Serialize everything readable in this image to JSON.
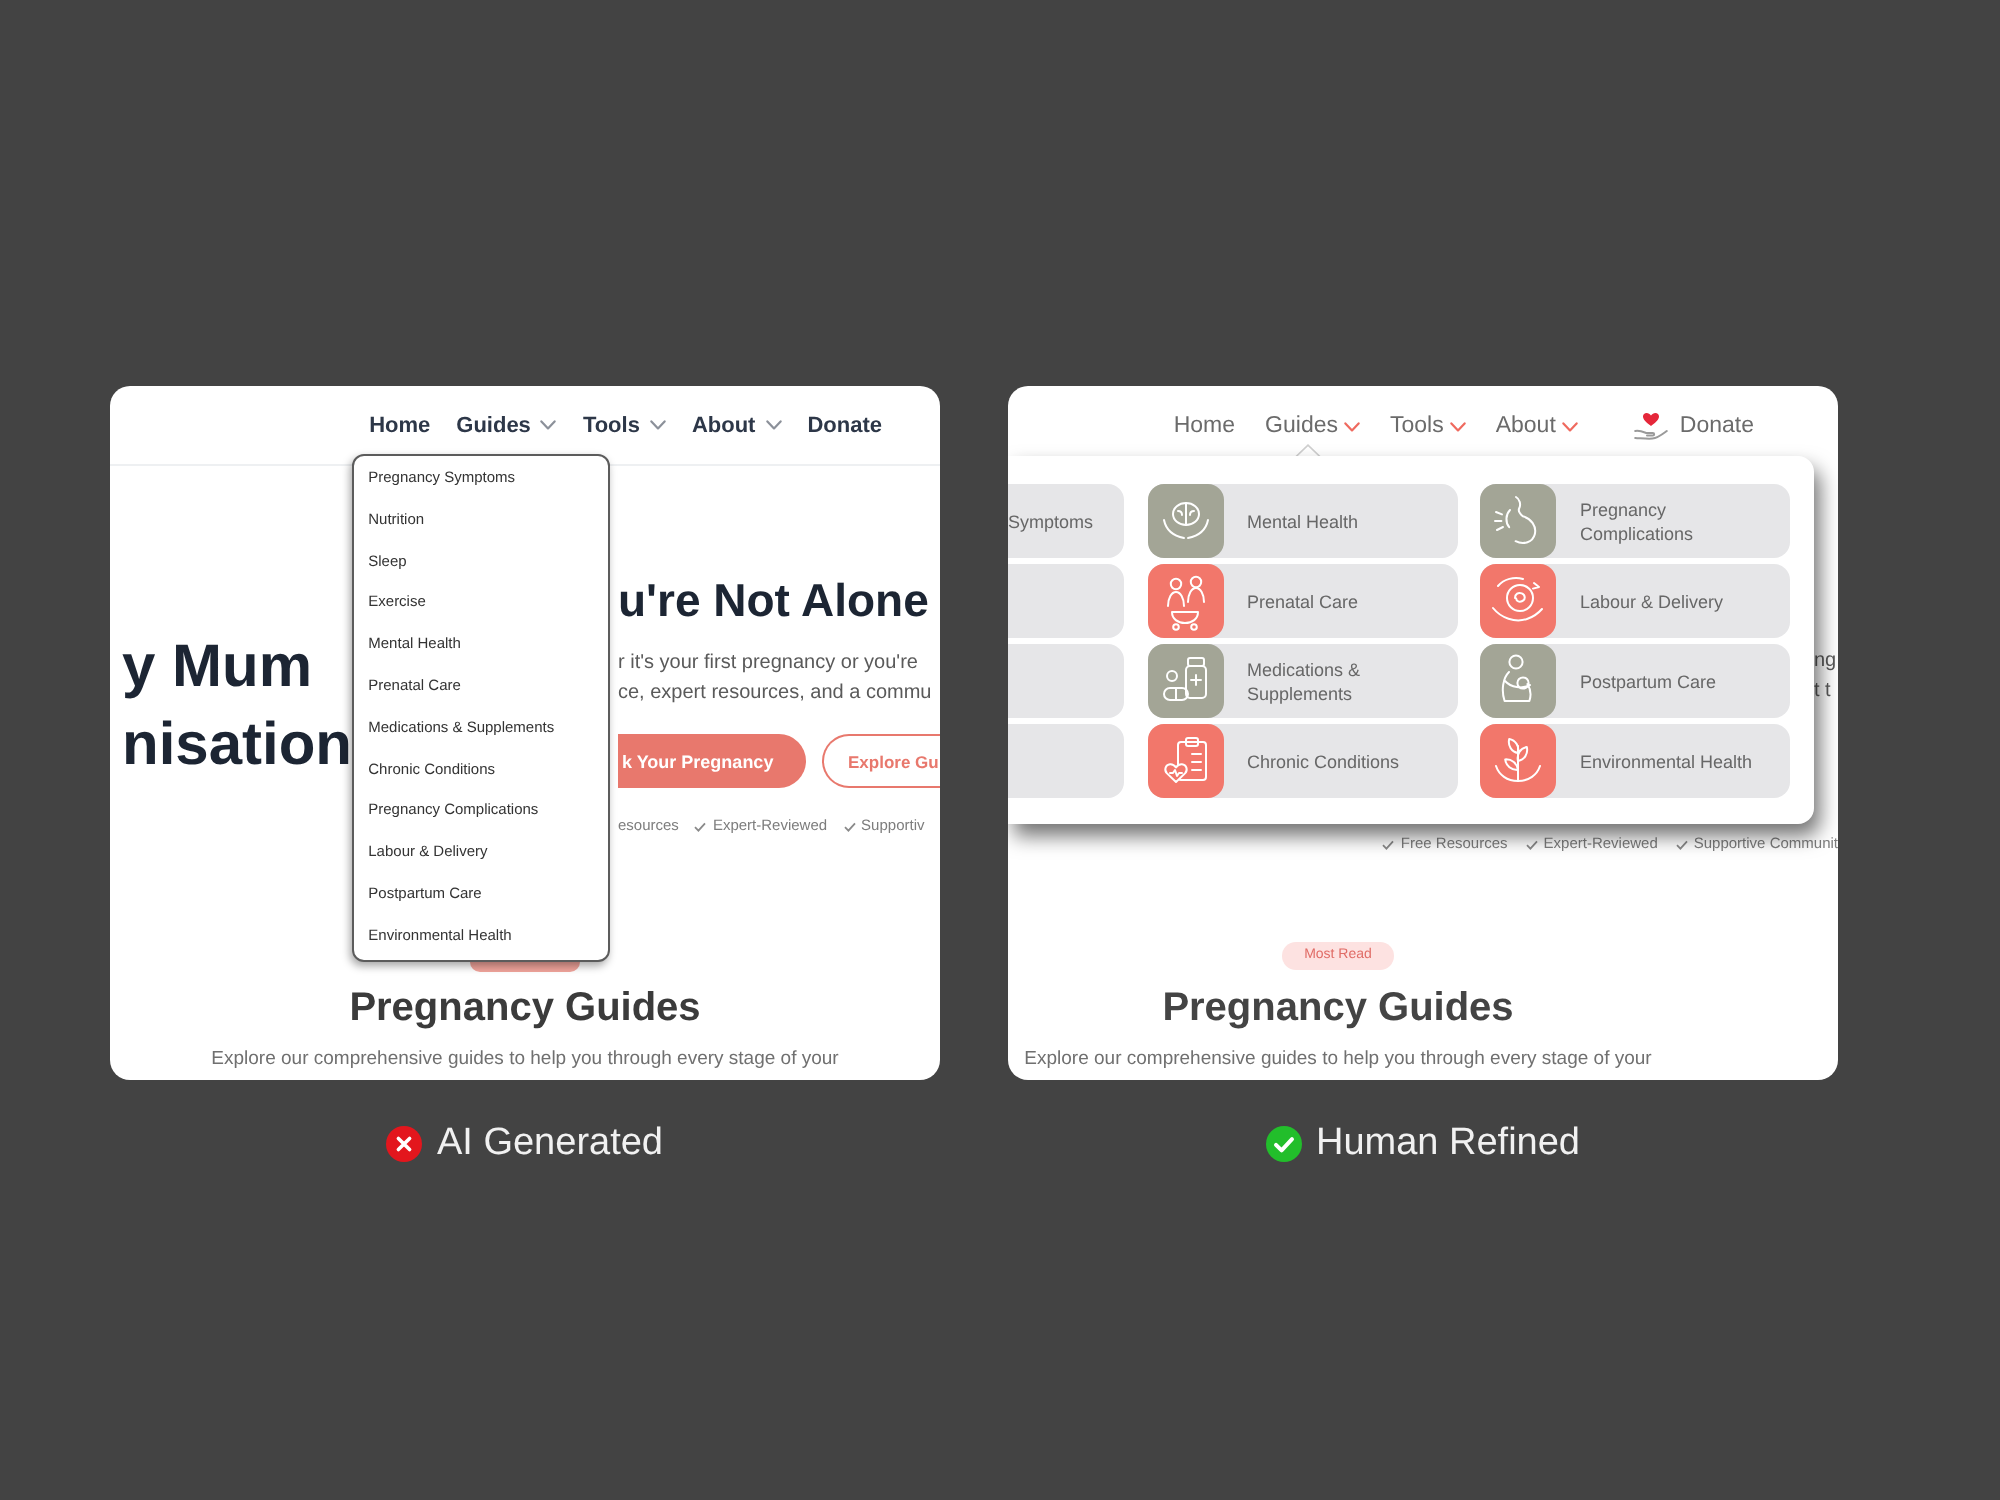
{
  "ai_version": {
    "nav": [
      {
        "label": "Home",
        "kind": "link"
      },
      {
        "label": "Guides",
        "kind": "menu",
        "menu_items": [
          "Pregnancy Symptoms",
          "Nutrition",
          "Sleep",
          "Exercise",
          "Mental Health",
          "Prenatal Care",
          "Medications & Supplements",
          "Chronic Conditions",
          "Pregnancy Complications",
          "Labour & Delivery",
          "Postpartum Care",
          "Environmental Health"
        ]
      },
      {
        "label": "Tools",
        "kind": "menu"
      },
      {
        "label": "About",
        "kind": "menu"
      },
      {
        "label": "Donate",
        "kind": "link"
      }
    ],
    "hero": {
      "title_lines": [
        "y Mum",
        "nisation"
      ],
      "heading": "u're Not Alone",
      "text_lines": [
        "r it's your first pregnancy or you're",
        "ce, expert resources, and a commu"
      ],
      "buttons": [
        {
          "label": "k Your Pregnancy",
          "kind": "primary"
        },
        {
          "label": "Explore Gu",
          "kind": "outline"
        }
      ],
      "checks": [
        {
          "label": "esources",
          "ticked": false
        },
        {
          "label": "Expert-Reviewed",
          "ticked": true
        },
        {
          "label": "Supportiv",
          "ticked": true
        }
      ]
    },
    "section": {
      "title": "Pregnancy Guides",
      "text": "Explore our comprehensive guides to help you through every stage of your"
    }
  },
  "human_version": {
    "nav": [
      {
        "label": "Home",
        "kind": "link"
      },
      {
        "label": "Guides",
        "kind": "menu",
        "mega_menu": [
          {
            "kind": "cut",
            "label": "Symptoms"
          },
          {
            "kind": "full",
            "label": "Mental Health",
            "color": "#a3a596"
          },
          {
            "kind": "full",
            "label": "Pregnancy Complications",
            "color": "#a3a596"
          },
          {
            "kind": "cut"
          },
          {
            "kind": "full",
            "label": "Prenatal Care",
            "color": "#f2776b"
          },
          {
            "kind": "full",
            "label": "Labour & Delivery",
            "color": "#f2776b"
          },
          {
            "kind": "cut"
          },
          {
            "kind": "full",
            "label": "Medications & Supplements",
            "color": "#a3a596"
          },
          {
            "kind": "full",
            "label": "Postpartum Care",
            "color": "#a3a596"
          },
          {
            "kind": "cut"
          },
          {
            "kind": "full",
            "label": "Chronic Conditions",
            "color": "#f2776b"
          },
          {
            "kind": "full",
            "label": "Environmental Health",
            "color": "#f2776b"
          }
        ]
      },
      {
        "label": "Tools",
        "kind": "menu"
      },
      {
        "label": "About",
        "kind": "menu"
      },
      {
        "label": "Donate",
        "kind": "donate"
      }
    ],
    "hero_fragments": [
      "ng",
      "t t"
    ],
    "checks": [
      {
        "label": "Free Resources",
        "ticked": true
      },
      {
        "label": "Expert-Reviewed",
        "ticked": true
      },
      {
        "label": "Supportive Communit",
        "ticked": true
      }
    ],
    "section": {
      "badge": "Most Read",
      "title": "Pregnancy Guides",
      "text": "Explore our comprehensive guides to help you through every stage of your"
    }
  },
  "captions": [
    {
      "label": "AI Generated",
      "kind": "cross"
    },
    {
      "label": "Human Refined",
      "kind": "check"
    }
  ]
}
